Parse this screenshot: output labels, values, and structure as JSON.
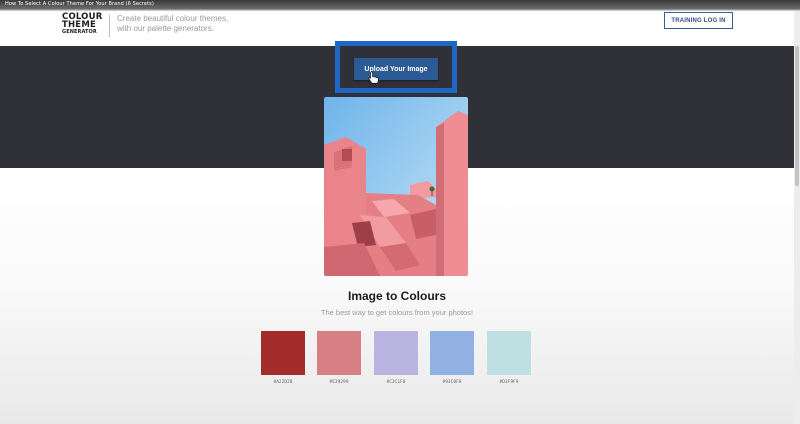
{
  "video": {
    "title": "How To Select A Colour Theme For Your Brand (6 Secrets)"
  },
  "header": {
    "logo": {
      "line1": "COLOUR",
      "line2": "THEME",
      "line3": "GENERATOR"
    },
    "tagline": {
      "line1": "Create beautiful colour themes,",
      "line2": "with our palette generators."
    },
    "training_button": "TRAINING LOG IN"
  },
  "hero": {
    "upload_button": "Upload Your Image"
  },
  "section": {
    "title": "Image to Colours",
    "subtitle": "The best way to get colours from your photos!"
  },
  "palette": [
    {
      "hex": "#A22D2B",
      "color": "#a22d2b"
    },
    {
      "hex": "#E39299",
      "color": "#d87f85"
    },
    {
      "hex": "#C3C1F0",
      "color": "#b9b5e0"
    },
    {
      "hex": "#93C0F8",
      "color": "#90b1e2"
    },
    {
      "hex": "#D3F9F9",
      "color": "#bee0e3"
    }
  ],
  "colors": {
    "dark_band": "#2f3038",
    "upload_button": "#2b5a94",
    "highlight_box": "#1f67c4",
    "training_border": "#3b5d97"
  }
}
